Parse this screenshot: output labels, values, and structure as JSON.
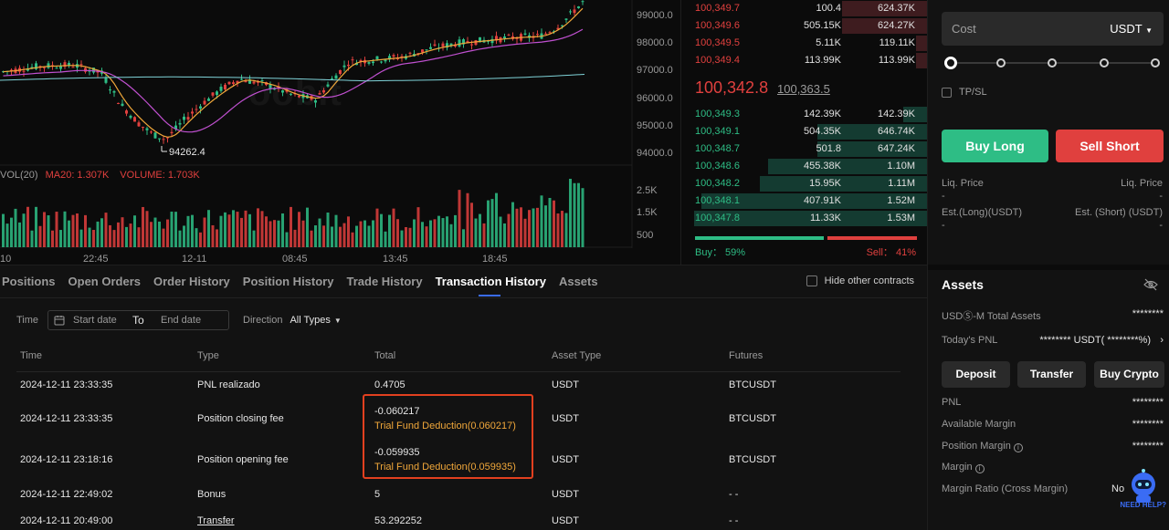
{
  "chart": {
    "price_ticks": [
      "99000.0",
      "98000.0",
      "97000.0",
      "96000.0",
      "95000.0",
      "94000.0"
    ],
    "low_label": "94262.4",
    "volume_legend": {
      "vol": "VOL(20)",
      "ma": "MA20: 1.307K",
      "volume": "VOLUME: 1.703K"
    },
    "volume_ticks": [
      "2.5K",
      "1.5K",
      "500"
    ],
    "time_ticks": [
      "10",
      "22:45",
      "12-11",
      "08:45",
      "13:45",
      "18:45"
    ],
    "watermark": "oobit"
  },
  "orderbook": {
    "asks": [
      {
        "price": "100,349.7",
        "amount": "100.4",
        "total": "624.37K",
        "depth": 0.35
      },
      {
        "price": "100,349.6",
        "amount": "505.15K",
        "total": "624.27K",
        "depth": 0.35
      },
      {
        "price": "100,349.5",
        "amount": "5.11K",
        "total": "119.11K",
        "depth": 0.05
      },
      {
        "price": "100,349.4",
        "amount": "113.99K",
        "total": "113.99K",
        "depth": 0.05
      }
    ],
    "last_price": "100,342.8",
    "mark_price": "100,363.5",
    "bids": [
      {
        "price": "100,349.3",
        "amount": "142.39K",
        "total": "142.39K",
        "depth": 0.1
      },
      {
        "price": "100,349.1",
        "amount": "504.35K",
        "total": "646.74K",
        "depth": 0.45
      },
      {
        "price": "100,348.7",
        "amount": "501.8",
        "total": "647.24K",
        "depth": 0.45
      },
      {
        "price": "100,348.6",
        "amount": "455.38K",
        "total": "1.10M",
        "depth": 0.65
      },
      {
        "price": "100,348.2",
        "amount": "15.95K",
        "total": "1.11M",
        "depth": 0.68
      },
      {
        "price": "100,348.1",
        "amount": "407.91K",
        "total": "1.52M",
        "depth": 0.92
      },
      {
        "price": "100,347.8",
        "amount": "11.33K",
        "total": "1.53M",
        "depth": 0.95
      }
    ],
    "buy_label": "Buy： 59%",
    "sell_label": "Sell： 41%",
    "buy_ratio": 0.59
  },
  "trade_panel": {
    "cost_label": "Cost",
    "cost_currency": "USDT",
    "tpsl_label": "TP/SL",
    "buy_long": "Buy Long",
    "sell_short": "Sell Short",
    "liq_price_left": "Liq. Price",
    "liq_price_right": "Liq. Price",
    "dash": "-",
    "est_long": "Est.(Long)(USDT)",
    "est_short": "Est. (Short) (USDT)",
    "colors": {
      "buy": "#2ebd85",
      "sell": "#e0403e"
    }
  },
  "assets": {
    "title": "Assets",
    "total_label": "USDⓈ-M Total Assets",
    "total_value": "********",
    "pnl_today_label": "Today's PNL",
    "pnl_today_value": "******** USDT( ********%)",
    "buttons": [
      "Deposit",
      "Transfer",
      "Buy Crypto"
    ],
    "rows": [
      {
        "label": "PNL",
        "value": "********"
      },
      {
        "label": "Available Margin",
        "value": "********"
      },
      {
        "label": "Position Margin",
        "value": "********"
      },
      {
        "label": "Margin",
        "value": ""
      },
      {
        "label": "Margin Ratio (Cross Margin)",
        "value": ""
      }
    ],
    "bot_partial": "No",
    "bot_label": "NEED HELP?"
  },
  "bottom": {
    "tabs": [
      "Positions",
      "Open Orders",
      "Order History",
      "Position History",
      "Trade History",
      "Transaction History",
      "Assets"
    ],
    "active_tab": "Transaction History",
    "hide_other": "Hide other contracts",
    "filter": {
      "time_label": "Time",
      "start_placeholder": "Start date",
      "to": "To",
      "end_placeholder": "End date",
      "direction_label": "Direction",
      "direction_value": "All Types"
    },
    "columns": [
      "Time",
      "Type",
      "Total",
      "Asset Type",
      "Futures"
    ],
    "rows": [
      {
        "time": "2024-12-11 23:33:35",
        "type": "PNL realizado",
        "total": "0.4705",
        "sub": "",
        "asset": "USDT",
        "futures": "BTCUSDT"
      },
      {
        "time": "2024-12-11 23:33:35",
        "type": "Position closing fee",
        "total": "-0.060217",
        "sub": "Trial Fund Deduction(0.060217)",
        "asset": "USDT",
        "futures": "BTCUSDT"
      },
      {
        "time": "2024-12-11 23:18:16",
        "type": "Position opening fee",
        "total": "-0.059935",
        "sub": "Trial Fund Deduction(0.059935)",
        "asset": "USDT",
        "futures": "BTCUSDT"
      },
      {
        "time": "2024-12-11 22:49:02",
        "type": "Bonus",
        "total": "5",
        "sub": "",
        "asset": "USDT",
        "futures": "- -"
      },
      {
        "time": "2024-12-11 20:49:00",
        "type": "Transfer",
        "total": "53.292252",
        "sub": "",
        "asset": "USDT",
        "futures": "- -"
      }
    ]
  }
}
